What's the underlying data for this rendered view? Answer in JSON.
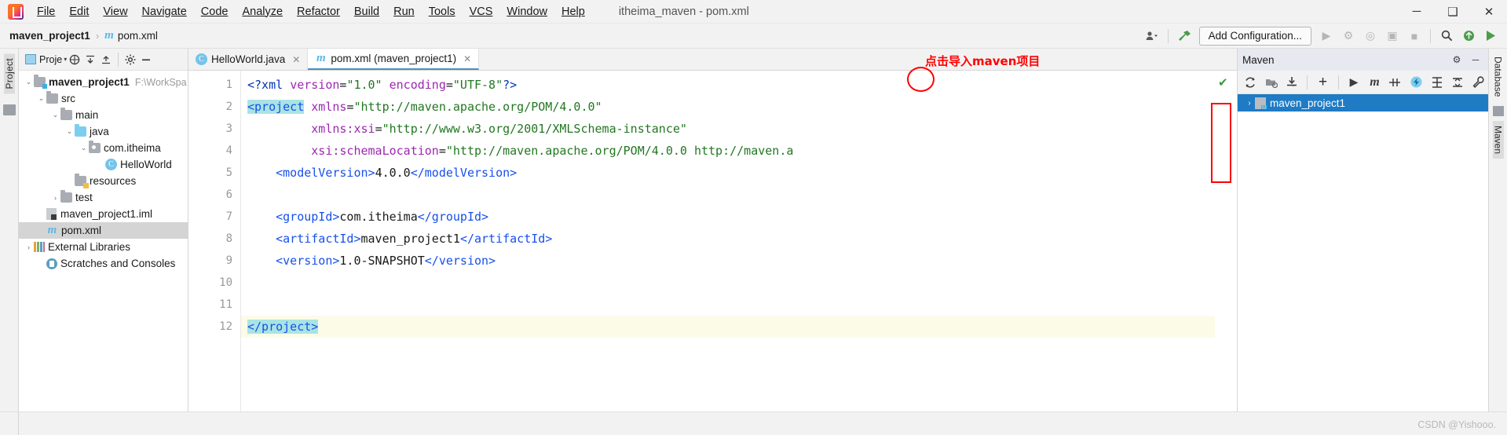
{
  "window": {
    "title": "itheima_maven - pom.xml",
    "controls": {
      "minimize": "─",
      "maximize": "❑",
      "close": "✕"
    }
  },
  "menubar": {
    "items": [
      {
        "label": "File"
      },
      {
        "label": "Edit"
      },
      {
        "label": "View"
      },
      {
        "label": "Navigate"
      },
      {
        "label": "Code"
      },
      {
        "label": "Analyze"
      },
      {
        "label": "Refactor"
      },
      {
        "label": "Build"
      },
      {
        "label": "Run"
      },
      {
        "label": "Tools"
      },
      {
        "label": "VCS"
      },
      {
        "label": "Window"
      },
      {
        "label": "Help"
      }
    ]
  },
  "navbar": {
    "breadcrumb": {
      "project": "maven_project1",
      "separator": "›",
      "file_icon": "m",
      "file": "pom.xml"
    },
    "add_configuration": "Add Configuration...",
    "icons": {
      "user": "user-icon",
      "build": "hammer-icon",
      "run": "▶",
      "debug": "⚙",
      "coverage": "◎",
      "profile": "▣",
      "stop": "■",
      "search": "⌕",
      "update": "⊕",
      "share": "▶"
    }
  },
  "left_strip": {
    "label": "Project",
    "structure_icon": "folder-icon"
  },
  "project_panel": {
    "header": {
      "title": "Proje",
      "caret": "▾"
    },
    "tree": [
      {
        "indent": 0,
        "arrow": "⌄",
        "icon": "module-folder",
        "label": "maven_project1",
        "path": "F:\\WorkSpa",
        "bold": true,
        "selected": false
      },
      {
        "indent": 1,
        "arrow": "⌄",
        "icon": "folder",
        "label": "src",
        "path": "",
        "bold": false,
        "selected": false
      },
      {
        "indent": 2,
        "arrow": "⌄",
        "icon": "folder",
        "label": "main",
        "path": "",
        "bold": false,
        "selected": false
      },
      {
        "indent": 3,
        "arrow": "⌄",
        "icon": "folder-source",
        "label": "java",
        "path": "",
        "bold": false,
        "selected": false
      },
      {
        "indent": 4,
        "arrow": "⌄",
        "icon": "package",
        "label": "com.itheima",
        "path": "",
        "bold": false,
        "selected": false
      },
      {
        "indent": 5,
        "arrow": "",
        "icon": "class",
        "label": "HelloWorld",
        "path": "",
        "bold": false,
        "selected": false
      },
      {
        "indent": 3,
        "arrow": "",
        "icon": "folder-resources",
        "label": "resources",
        "path": "",
        "bold": false,
        "selected": false
      },
      {
        "indent": 2,
        "arrow": "›",
        "icon": "folder",
        "label": "test",
        "path": "",
        "bold": false,
        "selected": false
      },
      {
        "indent": 1,
        "arrow": "",
        "icon": "iml",
        "label": "maven_project1.iml",
        "path": "",
        "bold": false,
        "selected": false
      },
      {
        "indent": 1,
        "arrow": "",
        "icon": "maven-m",
        "label": "pom.xml",
        "path": "",
        "bold": false,
        "selected": true
      },
      {
        "indent": 0,
        "arrow": "›",
        "icon": "library",
        "label": "External Libraries",
        "path": "",
        "bold": false,
        "selected": false
      },
      {
        "indent": 0,
        "arrow": "",
        "icon": "scratch",
        "label": "Scratches and Consoles",
        "path": "",
        "bold": false,
        "selected": false
      }
    ]
  },
  "editor": {
    "tabs": [
      {
        "icon": "C",
        "label": "HelloWorld.java",
        "active": false,
        "close": "✕"
      },
      {
        "icon": "m",
        "label": "pom.xml (maven_project1)",
        "active": true,
        "close": "✕"
      }
    ],
    "line_numbers": [
      "1",
      "2",
      "3",
      "4",
      "5",
      "6",
      "7",
      "8",
      "9",
      "10",
      "11",
      "12"
    ],
    "inspection_status": "✔",
    "code_lines": [
      {
        "n": 1,
        "highlight": false,
        "fold": false,
        "tokens": [
          {
            "t": "<?xml ",
            "c": "tg"
          },
          {
            "t": "version",
            "c": "at"
          },
          {
            "t": "=",
            "c": "tx"
          },
          {
            "t": "\"1.0\"",
            "c": "st"
          },
          {
            "t": " ",
            "c": "tx"
          },
          {
            "t": "encoding",
            "c": "at"
          },
          {
            "t": "=",
            "c": "tx"
          },
          {
            "t": "\"UTF-8\"",
            "c": "st"
          },
          {
            "t": "?>",
            "c": "tg"
          }
        ]
      },
      {
        "n": 2,
        "highlight": false,
        "fold": true,
        "tokens": [
          {
            "t": "<project",
            "c": "tg2 sel-hl"
          },
          {
            "t": " ",
            "c": "tx"
          },
          {
            "t": "xmlns",
            "c": "at"
          },
          {
            "t": "=",
            "c": "tx"
          },
          {
            "t": "\"http://maven.apache.org/POM/4.0.0\"",
            "c": "st"
          }
        ]
      },
      {
        "n": 3,
        "highlight": false,
        "fold": false,
        "tokens": [
          {
            "t": "         ",
            "c": "tx"
          },
          {
            "t": "xmlns:xsi",
            "c": "at"
          },
          {
            "t": "=",
            "c": "tx"
          },
          {
            "t": "\"http://www.w3.org/2001/XMLSchema-instance\"",
            "c": "st"
          }
        ]
      },
      {
        "n": 4,
        "highlight": false,
        "fold": false,
        "tokens": [
          {
            "t": "         ",
            "c": "tx"
          },
          {
            "t": "xsi:schemaLocation",
            "c": "at"
          },
          {
            "t": "=",
            "c": "tx"
          },
          {
            "t": "\"http://maven.apache.org/POM/4.0.0 http://maven.a",
            "c": "st"
          }
        ]
      },
      {
        "n": 5,
        "highlight": false,
        "fold": false,
        "tokens": [
          {
            "t": "    ",
            "c": "tx"
          },
          {
            "t": "<modelVersion>",
            "c": "tg2"
          },
          {
            "t": "4.0.0",
            "c": "tx"
          },
          {
            "t": "</modelVersion>",
            "c": "tg2"
          }
        ]
      },
      {
        "n": 6,
        "highlight": false,
        "fold": false,
        "tokens": []
      },
      {
        "n": 7,
        "highlight": false,
        "fold": false,
        "tokens": [
          {
            "t": "    ",
            "c": "tx"
          },
          {
            "t": "<groupId>",
            "c": "tg2"
          },
          {
            "t": "com.itheima",
            "c": "tx"
          },
          {
            "t": "</groupId>",
            "c": "tg2"
          }
        ]
      },
      {
        "n": 8,
        "highlight": false,
        "fold": false,
        "tokens": [
          {
            "t": "    ",
            "c": "tx"
          },
          {
            "t": "<artifactId>",
            "c": "tg2"
          },
          {
            "t": "maven_project1",
            "c": "tx"
          },
          {
            "t": "</artifactId>",
            "c": "tg2"
          }
        ]
      },
      {
        "n": 9,
        "highlight": false,
        "fold": false,
        "tokens": [
          {
            "t": "    ",
            "c": "tx"
          },
          {
            "t": "<version>",
            "c": "tg2"
          },
          {
            "t": "1.0-SNAPSHOT",
            "c": "tx"
          },
          {
            "t": "</version>",
            "c": "tg2"
          }
        ]
      },
      {
        "n": 10,
        "highlight": false,
        "fold": false,
        "tokens": []
      },
      {
        "n": 11,
        "highlight": false,
        "fold": false,
        "tokens": []
      },
      {
        "n": 12,
        "highlight": true,
        "fold": true,
        "tokens": [
          {
            "t": "</project>",
            "c": "tg2 sel-hl"
          }
        ]
      }
    ]
  },
  "maven_panel": {
    "title": "Maven",
    "header_icons": {
      "settings": "⚙",
      "hide": "─"
    },
    "toolbar": [
      {
        "name": "reload-all-maven-projects",
        "glyph": "↻"
      },
      {
        "name": "generate-sources",
        "glyph": "▰"
      },
      {
        "name": "download-sources",
        "glyph": "⤓"
      },
      {
        "name": "add-maven-project",
        "glyph": "+"
      },
      {
        "name": "run-maven-build",
        "glyph": "▶"
      },
      {
        "name": "execute-maven-goal",
        "glyph": "m"
      },
      {
        "name": "toggle-skip-tests",
        "glyph": "⫴"
      },
      {
        "name": "toggle-offline-mode",
        "glyph": "⚡"
      },
      {
        "name": "show-dependencies",
        "glyph": "≡"
      },
      {
        "name": "expand-collapse",
        "glyph": "⨍"
      },
      {
        "name": "maven-settings",
        "glyph": "ὒ7"
      }
    ],
    "tree": [
      {
        "arrow": "›",
        "label": "maven_project1",
        "selected": true
      }
    ]
  },
  "right_strip": {
    "labels": [
      {
        "text": "Database",
        "selected": false
      },
      {
        "text": "Maven",
        "selected": true
      }
    ]
  },
  "annotations": {
    "import_hint": "点击导入maven项目",
    "color": "#ff0000"
  },
  "watermark": "CSDN @Yishooo."
}
